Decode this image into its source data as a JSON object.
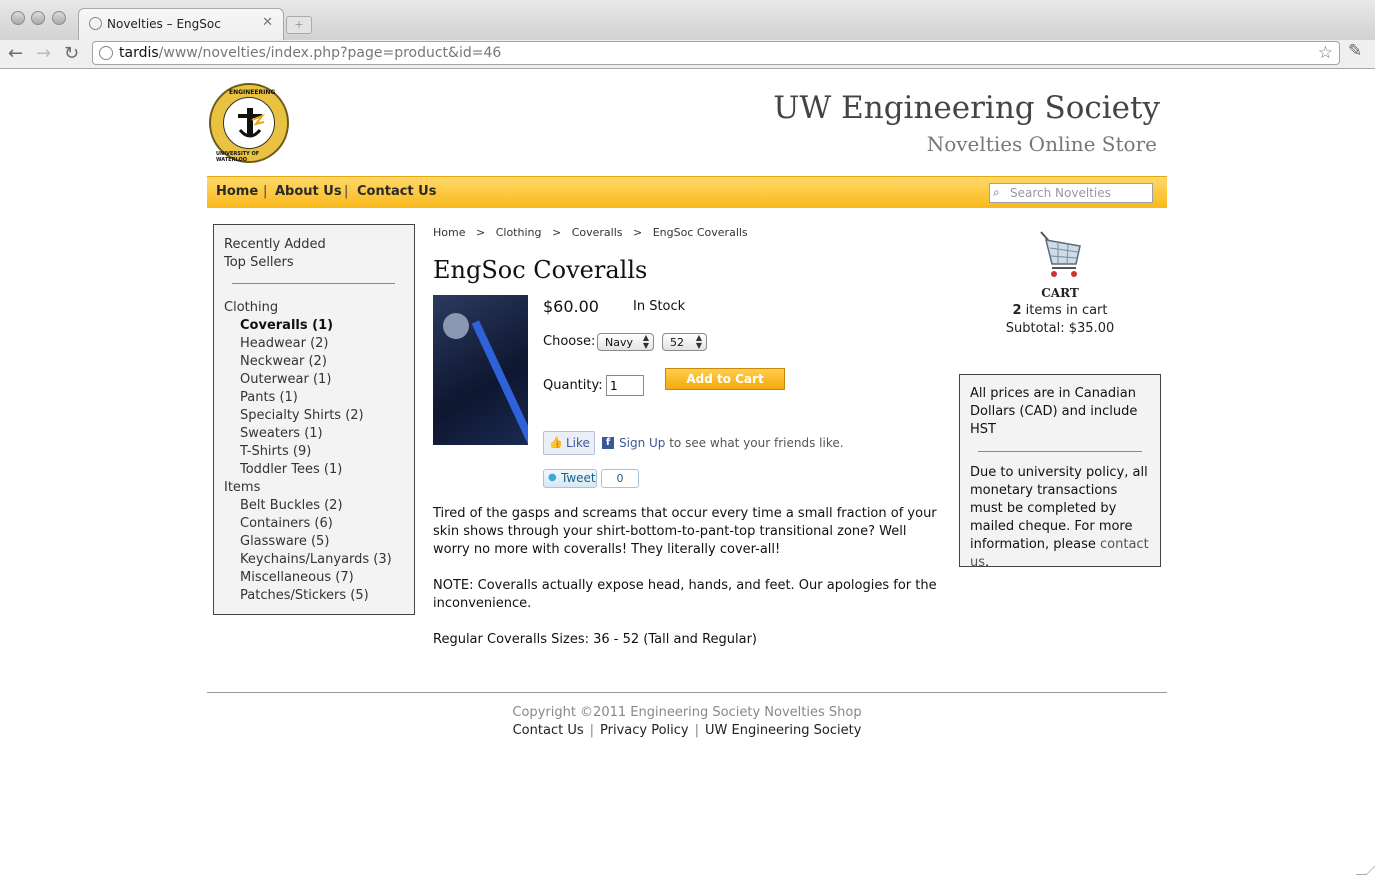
{
  "browser": {
    "tab_title": "Novelties – EngSoc",
    "url_host": "tardis",
    "url_path": "/www/novelties/index.php?page=product&id=46"
  },
  "site": {
    "title": "UW Engineering Society",
    "subtitle": "Novelties Online Store",
    "logo_top_text": "ENGINEERING",
    "logo_bottom_text": "UNIVERSITY OF WATERLOO"
  },
  "nav": {
    "home": "Home",
    "about": "About Us",
    "contact": "Contact Us",
    "sep": "|",
    "search_placeholder": "Search Novelties"
  },
  "sidebar": {
    "recent": "Recently Added",
    "top": "Top Sellers",
    "clothing": "Clothing",
    "clothing_items": [
      "Coveralls (1)",
      "Headwear (2)",
      "Neckwear (2)",
      "Outerwear (1)",
      "Pants (1)",
      "Specialty Shirts (2)",
      "Sweaters (1)",
      "T-Shirts (9)",
      "Toddler Tees (1)"
    ],
    "items": "Items",
    "items_list": [
      "Belt Buckles (2)",
      "Containers (6)",
      "Glassware (5)",
      "Keychains/Lanyards (3)",
      "Miscellaneous (7)",
      "Patches/Stickers (5)"
    ]
  },
  "breadcrumb": [
    "Home",
    ">",
    "Clothing",
    ">",
    "Coveralls",
    ">",
    "EngSoc Coveralls"
  ],
  "product": {
    "title": "EngSoc Coveralls",
    "price": "$60.00",
    "stock": "In Stock",
    "choose_label": "Choose:",
    "color_value": "Navy",
    "size_value": "52",
    "quantity_label": "Quantity:",
    "quantity_value": "1",
    "add_to_cart": "Add to Cart",
    "like_label": "Like",
    "signup_link": "Sign Up",
    "signup_text": " to see what your friends like.",
    "tweet_label": "Tweet",
    "tweet_count": "0",
    "description": [
      "Tired of the gasps and screams that occur every time a small fraction of your skin shows through your shirt-bottom-to-pant-top transitional zone? Well worry no more with coveralls! They literally cover-all!",
      "NOTE: Coveralls actually expose head, hands, and feet. Our apologies for the inconvenience.",
      "Regular Coveralls Sizes: 36 - 52 (Tall and Regular)"
    ]
  },
  "cart": {
    "title": "CART",
    "count": "2",
    "items_text": " items in cart",
    "subtotal": "Subtotal: $35.00"
  },
  "info": {
    "currency": "All prices are in Canadian Dollars (CAD) and include HST",
    "policy": "Due to university policy, all monetary transactions must be completed by mailed cheque. For more information, please ",
    "contact_link": "contact us",
    "end": "."
  },
  "footer": {
    "copyright": "Copyright ©2011 Engineering Society Novelties Shop",
    "links": [
      "Contact Us",
      "Privacy Policy",
      "UW Engineering Society"
    ],
    "sep": "|"
  }
}
